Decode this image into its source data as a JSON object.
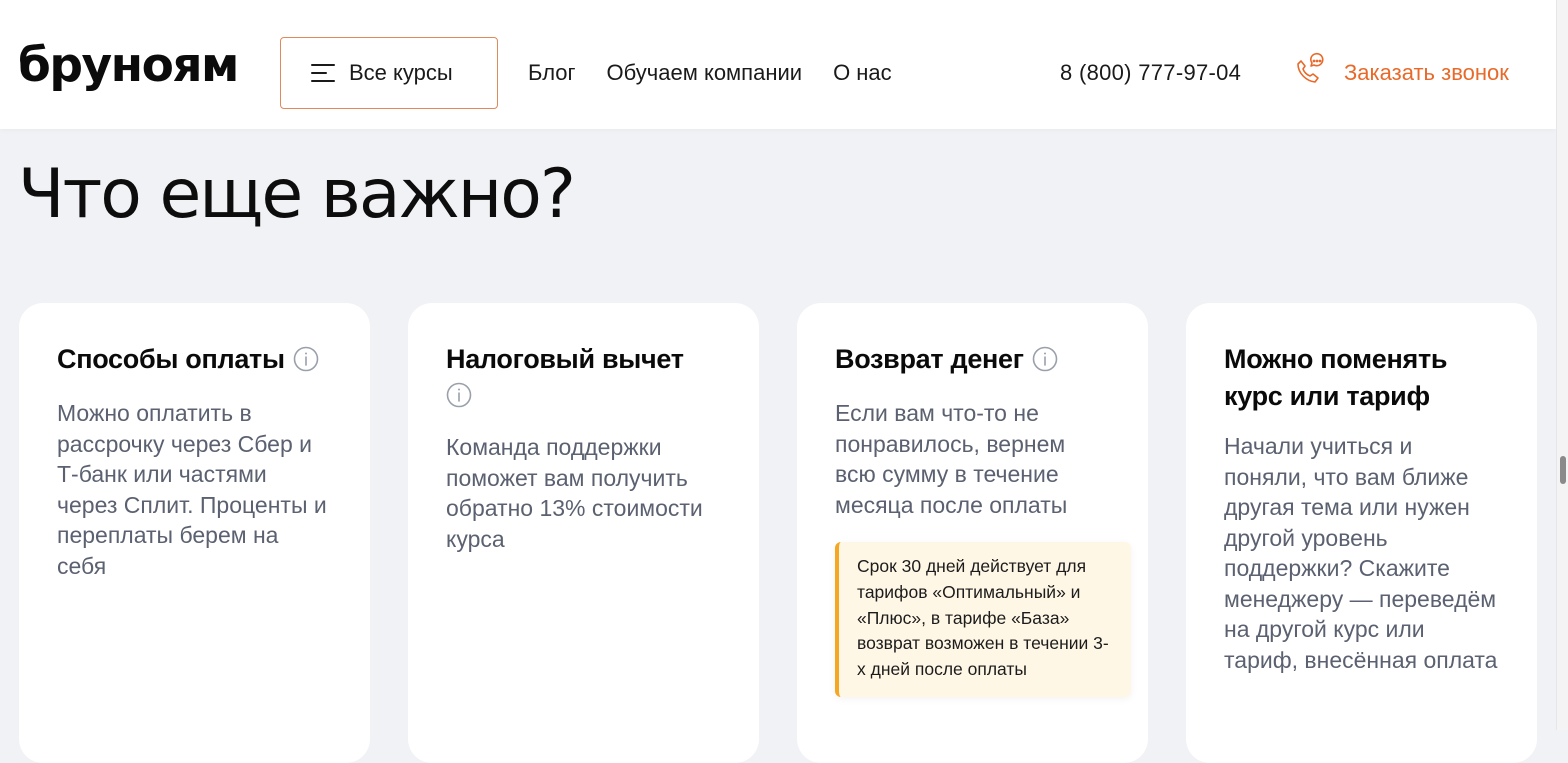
{
  "header": {
    "logo": "бруноям",
    "all_courses_label": "Все курсы",
    "nav": [
      "Блог",
      "Обучаем компании",
      "О нас"
    ],
    "phone": "8 (800) 777-97-04",
    "callback_label": "Заказать звонок"
  },
  "main": {
    "title": "Что еще важно?",
    "cards": [
      {
        "title": "Способы оплаты",
        "text": "Можно оплатить в рассрочку через Сбер и Т-банк или частями через Сплит. Проценты и переплаты берем на себя"
      },
      {
        "title": "Налоговый вычет",
        "text": "Команда поддержки поможет вам получить обратно 13% стоимости курса"
      },
      {
        "title": "Возврат денег",
        "text": "Если вам что-то не понравилось, вернем всю сумму в течение месяца после оплаты",
        "note": "Срок 30 дней действует для тарифов «Оптимальный» и «Плюс», в тарифе «База» возврат возможен в течении 3-х дней после оплаты"
      },
      {
        "title": "Можно поменять курс или тариф",
        "text": "Начали учиться и поняли, что вам ближе другая тема или нужен другой уровень поддержки? Скажите менеджеру — переведём на другой курс или тариф, внесённая оплата"
      }
    ]
  },
  "colors": {
    "accent": "#e86a2a",
    "note_border": "#f5a623",
    "note_bg": "#fff7e6",
    "page_bg": "#f1f2f5"
  },
  "icons": {
    "menu": "menu-icon",
    "phone": "phone-chat-icon",
    "info": "info-icon"
  }
}
